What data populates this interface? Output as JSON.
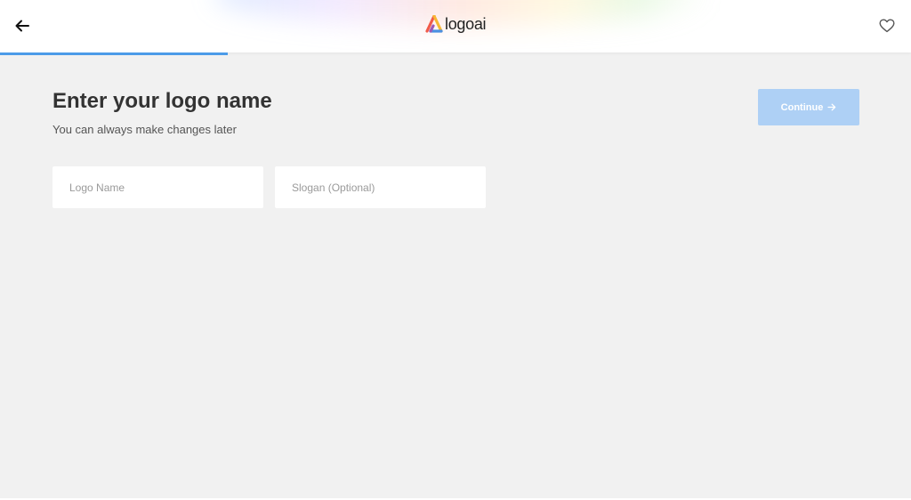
{
  "header": {
    "back_icon": "arrow-left-icon",
    "logo_text": "logoai",
    "favorite_icon": "heart-icon"
  },
  "progress": {
    "fraction": 0.25,
    "color": "#4c9be8"
  },
  "main": {
    "title": "Enter your logo name",
    "subtitle": "You can always make changes later",
    "continue_label": "Continue",
    "continue_icon": "arrow-right-icon",
    "continue_color": "#aed0f5",
    "logo_name": {
      "value": "",
      "placeholder": "Logo Name"
    },
    "slogan": {
      "value": "",
      "placeholder": "Slogan (Optional)"
    }
  }
}
